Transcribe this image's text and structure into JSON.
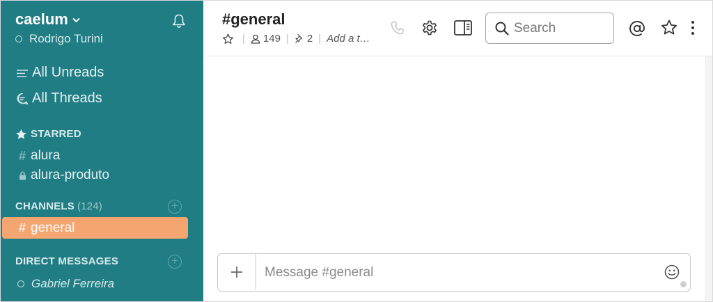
{
  "sidebar": {
    "team_name": "caelum",
    "user_name": "Rodrigo Turini",
    "nav": [
      {
        "label": "All Unreads",
        "icon": "unreads-icon"
      },
      {
        "label": "All Threads",
        "icon": "threads-icon"
      }
    ],
    "starred": {
      "heading": "STARRED",
      "channels": [
        {
          "prefix": "#",
          "name": "alura"
        },
        {
          "prefix": "lock",
          "name": "alura-produto"
        }
      ]
    },
    "channels": {
      "heading": "CHANNELS",
      "count": "(124)",
      "items": [
        {
          "prefix": "#",
          "name": "general",
          "active": true
        }
      ]
    },
    "direct_messages": {
      "heading": "DIRECT MESSAGES",
      "items": [
        {
          "name": "Gabriel Ferreira"
        }
      ]
    }
  },
  "header": {
    "channel_title": "#general",
    "members_count": "149",
    "pinned_count": "2",
    "topic_placeholder": "Add a t…",
    "search_placeholder": "Search"
  },
  "composer": {
    "placeholder": "Message #general"
  },
  "colors": {
    "sidebar_bg": "#217d84",
    "active_channel_bg": "#f5a56f"
  }
}
